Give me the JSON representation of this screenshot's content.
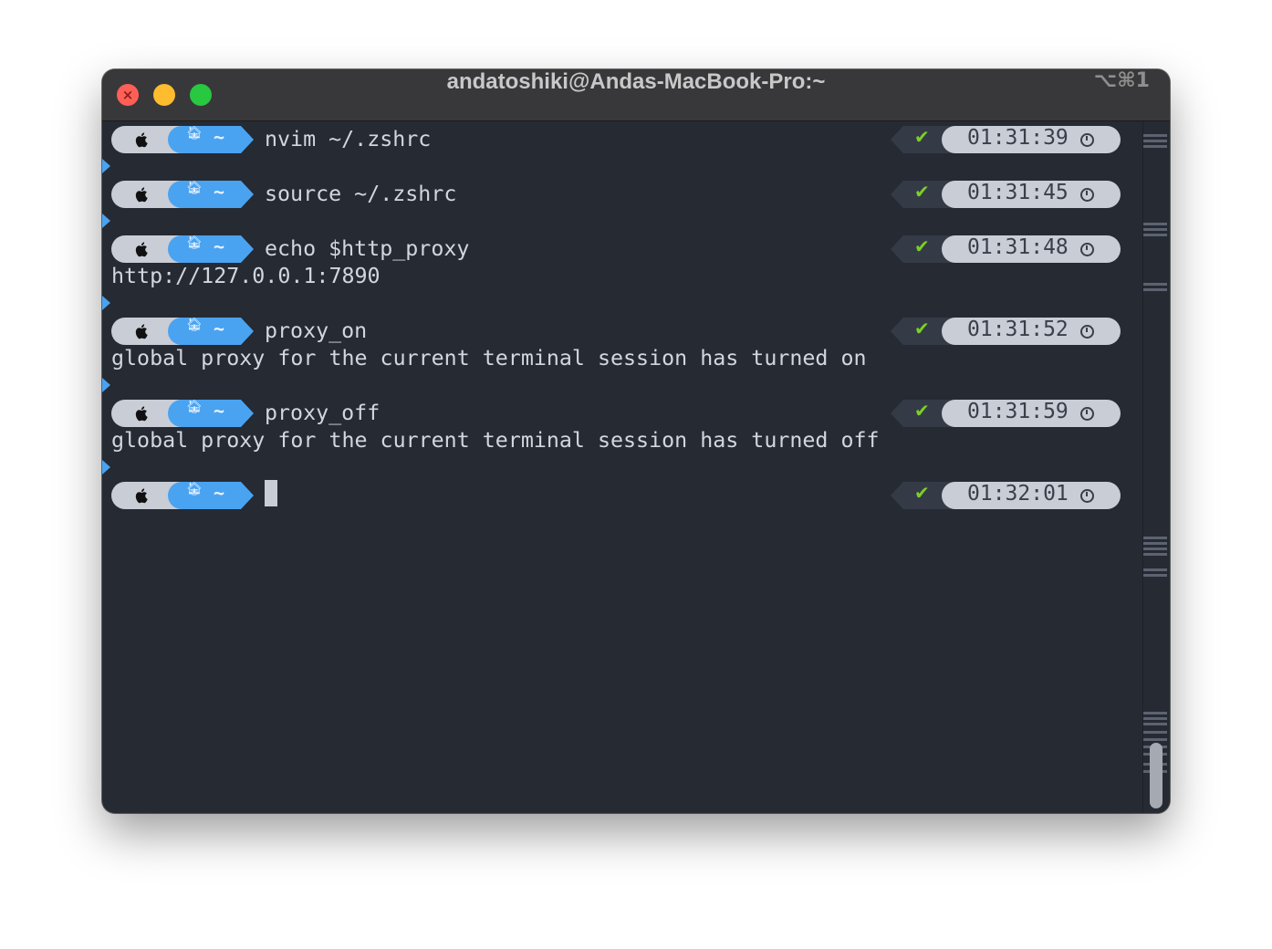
{
  "window": {
    "title": "andatoshiki@Andas-MacBook-Pro:~",
    "shortcut": "⌥⌘1"
  },
  "prompt": {
    "dir_label": "~",
    "status_symbol": "✔"
  },
  "terminal": {
    "entries": [
      {
        "command": "nvim ~/.zshrc",
        "time": "01:31:39",
        "output": []
      },
      {
        "command": "source ~/.zshrc",
        "time": "01:31:45",
        "output": []
      },
      {
        "command": "echo $http_proxy",
        "time": "01:31:48",
        "output": [
          "http://127.0.0.1:7890"
        ]
      },
      {
        "command": "proxy_on",
        "time": "01:31:52",
        "output": [
          "global proxy for the current terminal session has turned on"
        ]
      },
      {
        "command": "proxy_off",
        "time": "01:31:59",
        "output": [
          "global proxy for the current terminal session has turned off"
        ]
      },
      {
        "command": "",
        "time": "01:32:01",
        "output": []
      }
    ]
  },
  "colors": {
    "background": "#262a33",
    "dir_segment": "#4aa3f0",
    "os_segment": "#c9cdd6",
    "status_ok": "#7ccf2a",
    "text": "#d2d6dd"
  },
  "icons": {
    "close": "close-icon",
    "os": "apple-icon",
    "home": "home-icon",
    "status": "checkmark-icon",
    "time": "clock-icon",
    "continuation": "chevron-right-icon"
  }
}
